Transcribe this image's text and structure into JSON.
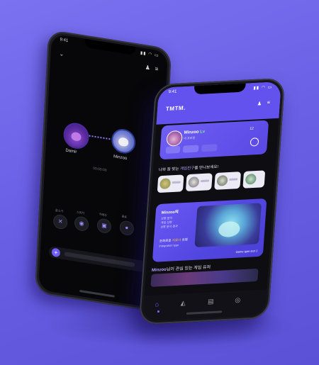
{
  "colors": {
    "background": "#6a60e6",
    "accent": "#6352ee",
    "highlight": "#b5a8ff",
    "level": "#7bf09a"
  },
  "phone_back": {
    "status_time": "9:41",
    "icons": [
      "chevron-down-icon",
      "user-icon",
      "menu-icon"
    ],
    "participants": [
      {
        "name": "Damir"
      },
      {
        "name": "Minzoo"
      }
    ],
    "subtitle": "00:00:00",
    "actions": [
      {
        "label": "음소거",
        "icon": "mic-off-icon"
      },
      {
        "label": "스피커",
        "icon": "speaker-icon"
      },
      {
        "label": "카메라",
        "icon": "camera-icon"
      },
      {
        "label": "종료",
        "icon": "end-call-icon"
      }
    ],
    "plus_label": "+"
  },
  "phone_front": {
    "status_time": "9:41",
    "logo": "TMTM.",
    "profile": {
      "name": "Minzoo",
      "level": "Lv",
      "subtitle": "내 프로필",
      "stat": "12"
    },
    "section_friends": {
      "prefix": "나와 잘 맞는 ",
      "highlight": "게임친구",
      "suffix": "를 만나보세요!"
    },
    "banner": {
      "title": "Minzoo의",
      "lines": [
        "성향 분석",
        "게임 성향",
        "성향 분석 결과"
      ],
      "tag_prefix": "조화로운 ",
      "tag_highlight": "치료사",
      "tag_suffix": " 유형",
      "tag_sub": "Integration type",
      "footer": "Game type test 1"
    },
    "section_bottom": {
      "highlight": "Minzoo",
      "suffix": "님이 관심 있는 게임 유저"
    },
    "tabs": [
      {
        "icon": "home-icon",
        "active": true
      },
      {
        "icon": "megaphone-icon",
        "active": false
      },
      {
        "icon": "chat-icon",
        "active": false
      },
      {
        "icon": "ring-icon",
        "active": false
      }
    ]
  }
}
